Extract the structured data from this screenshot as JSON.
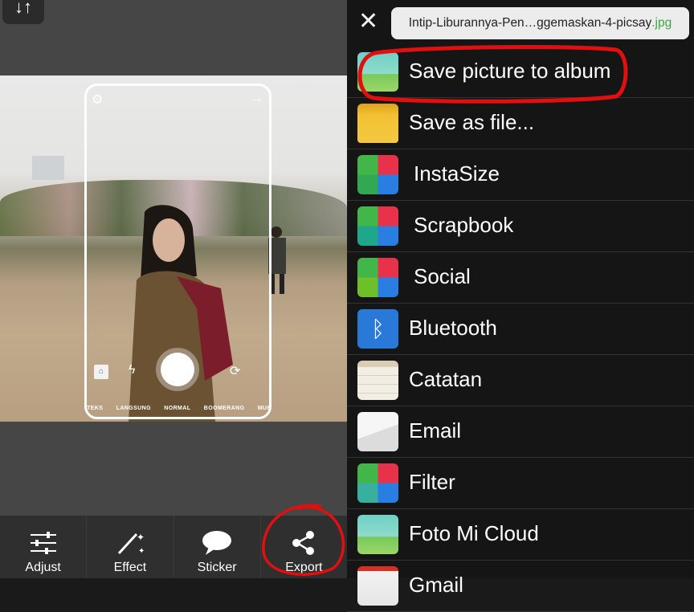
{
  "editor": {
    "toolbar": [
      {
        "label": "Adjust",
        "icon": "sliders-icon"
      },
      {
        "label": "Effect",
        "icon": "magic-wand-icon"
      },
      {
        "label": "Sticker",
        "icon": "speech-bubble-icon"
      },
      {
        "label": "Export",
        "icon": "share-icon"
      }
    ],
    "camera_modes": [
      "TEKS",
      "LANGSUNG",
      "NORMAL",
      "BOOMERANG",
      "MUN"
    ]
  },
  "export_sheet": {
    "filename_main": "Intip-Liburannya-Pen…ggemaskan-4-picsay",
    "filename_ext": ".jpg",
    "items": [
      {
        "label": "Save picture to album",
        "icon": "gallery-icon"
      },
      {
        "label": "Save as file...",
        "icon": "folder-icon"
      },
      {
        "label": "InstaSize",
        "icon": "picsay-instasize-icon"
      },
      {
        "label": "Scrapbook",
        "icon": "picsay-scrapbook-icon"
      },
      {
        "label": "Social",
        "icon": "picsay-social-icon"
      },
      {
        "label": "Bluetooth",
        "icon": "bluetooth-icon"
      },
      {
        "label": "Catatan",
        "icon": "notes-icon"
      },
      {
        "label": "Email",
        "icon": "email-icon"
      },
      {
        "label": "Filter",
        "icon": "picsay-filter-icon"
      },
      {
        "label": "Foto Mi Cloud",
        "icon": "mi-cloud-gallery-icon"
      },
      {
        "label": "Gmail",
        "icon": "gmail-icon"
      }
    ]
  },
  "colors": {
    "highlight": "#e01010",
    "accent_green": "#3aa842",
    "bluetooth": "#2979d9"
  }
}
